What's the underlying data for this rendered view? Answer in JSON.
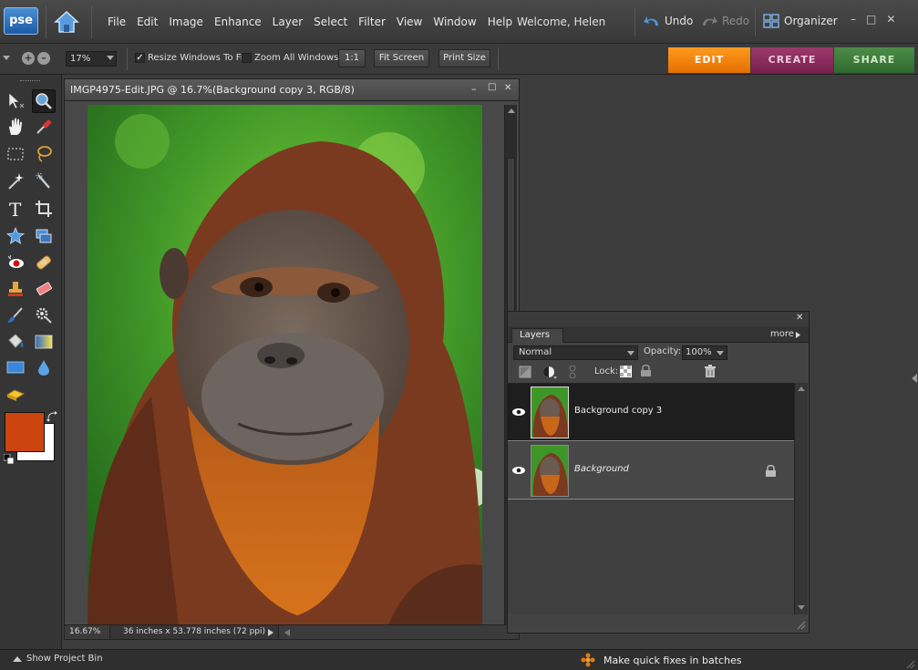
{
  "app": {
    "logo_text": "pse",
    "welcome": "Welcome, Helen"
  },
  "menu": [
    "File",
    "Edit",
    "Image",
    "Enhance",
    "Layer",
    "Select",
    "Filter",
    "View",
    "Window",
    "Help"
  ],
  "history": {
    "undo": "Undo",
    "redo": "Redo"
  },
  "organizer": "Organizer",
  "options": {
    "zoom": "17%",
    "resize_windows": "Resize Windows To Fit",
    "resize_checked": "✓",
    "zoom_all": "Zoom All Windows",
    "one_to_one": "1:1",
    "fit_screen": "Fit Screen",
    "print_size": "Print Size"
  },
  "modes": [
    {
      "label": "EDIT",
      "color": "#f07d00"
    },
    {
      "label": "CREATE",
      "color": "#8a2a5a"
    },
    {
      "label": "SHARE",
      "color": "#3d7a3a"
    }
  ],
  "colors": {
    "foreground": "#cc4410",
    "background": "#ffffff"
  },
  "document": {
    "title": "IMGP4975-Edit.JPG @ 16.7%(Background copy 3, RGB/8)",
    "zoom": "16.67%",
    "dimensions": "36 inches x 53.778 inches (72 ppi)"
  },
  "layers": {
    "tab": "Layers",
    "more": "more",
    "blend_mode": "Normal",
    "opacity_label": "Opacity:",
    "opacity": "100%",
    "lock_label": "Lock:",
    "items": [
      {
        "name": "Background copy 3",
        "selected": true
      },
      {
        "name": "Background",
        "locked": true
      }
    ]
  },
  "bottom": {
    "project_bin": "Show Project Bin",
    "tip": "Make quick fixes in batches"
  }
}
